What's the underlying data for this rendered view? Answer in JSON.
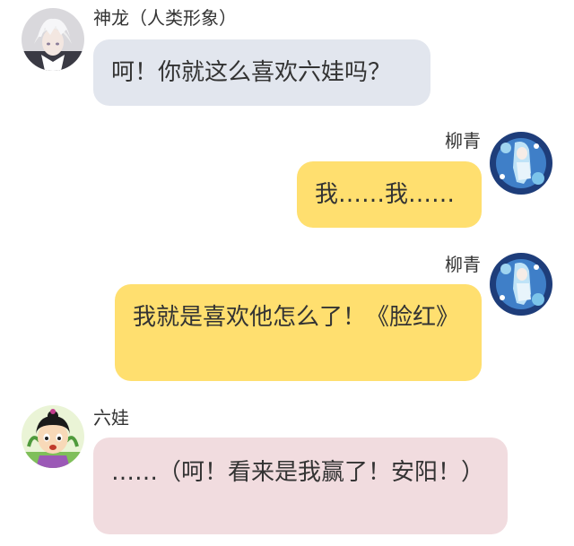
{
  "messages": [
    {
      "sender": "神龙（人类形象）",
      "side": "left",
      "avatar_icon": "silver-hair-character-avatar-icon",
      "text": "呵！你就这么喜欢六娃吗？",
      "bubble_color": "#e2e6ee"
    },
    {
      "sender": "柳青",
      "side": "right",
      "avatar_icon": "blue-hair-character-avatar-icon",
      "text": "我……我……",
      "bubble_color": "#ffdf6f"
    },
    {
      "sender": "柳青",
      "side": "right",
      "avatar_icon": "blue-hair-character-avatar-icon",
      "text": "我就是喜欢他怎么了！《脸红》",
      "bubble_color": "#ffdf6f"
    },
    {
      "sender": "六娃",
      "side": "left",
      "avatar_icon": "cartoon-child-avatar-icon",
      "text": "……（呵！看来是我赢了！安阳！）",
      "bubble_color": "#f1dcdf"
    }
  ]
}
